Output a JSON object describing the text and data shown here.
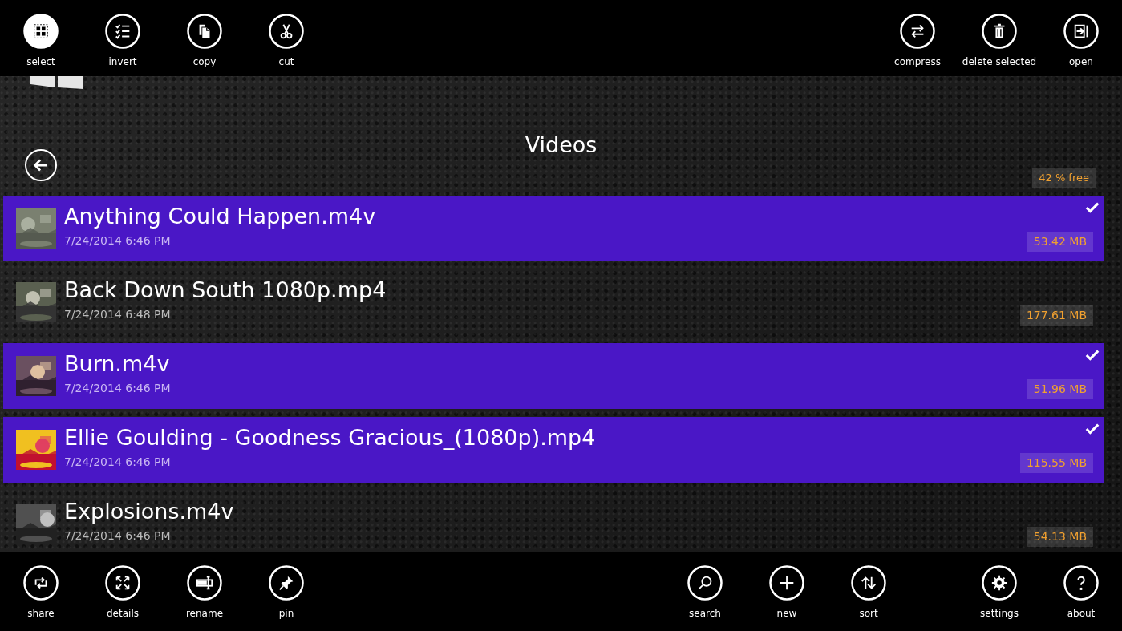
{
  "top_bar": {
    "left": [
      {
        "label": "select",
        "selected": true
      },
      {
        "label": "invert",
        "selected": false
      },
      {
        "label": "copy",
        "selected": false
      },
      {
        "label": "cut",
        "selected": false
      }
    ],
    "right": [
      {
        "label": "compress",
        "selected": false
      },
      {
        "label": "delete selected",
        "selected": false
      },
      {
        "label": "open",
        "selected": false
      }
    ]
  },
  "folder": {
    "title": "Videos",
    "free": "42 % free"
  },
  "files": [
    {
      "name": "Anything Could Happen.m4v",
      "date": "7/24/2014 6:46 PM",
      "size": "53.42 MB",
      "selected": true
    },
    {
      "name": "Back Down South 1080p.mp4",
      "date": "7/24/2014 6:48 PM",
      "size": "177.61 MB",
      "selected": false
    },
    {
      "name": "Burn.m4v",
      "date": "7/24/2014 6:46 PM",
      "size": "51.96 MB",
      "selected": true
    },
    {
      "name": "Ellie Goulding - Goodness Gracious_(1080p).mp4",
      "date": "7/24/2014 6:46 PM",
      "size": "115.55 MB",
      "selected": true
    },
    {
      "name": "Explosions.m4v",
      "date": "7/24/2014 6:46 PM",
      "size": "54.13 MB",
      "selected": false
    }
  ],
  "bottom_bar": {
    "left": [
      {
        "label": "share"
      },
      {
        "label": "details"
      },
      {
        "label": "rename"
      },
      {
        "label": "pin"
      }
    ],
    "right": [
      {
        "label": "search"
      },
      {
        "label": "new"
      },
      {
        "label": "sort"
      },
      {
        "label": "settings"
      },
      {
        "label": "about"
      }
    ]
  }
}
